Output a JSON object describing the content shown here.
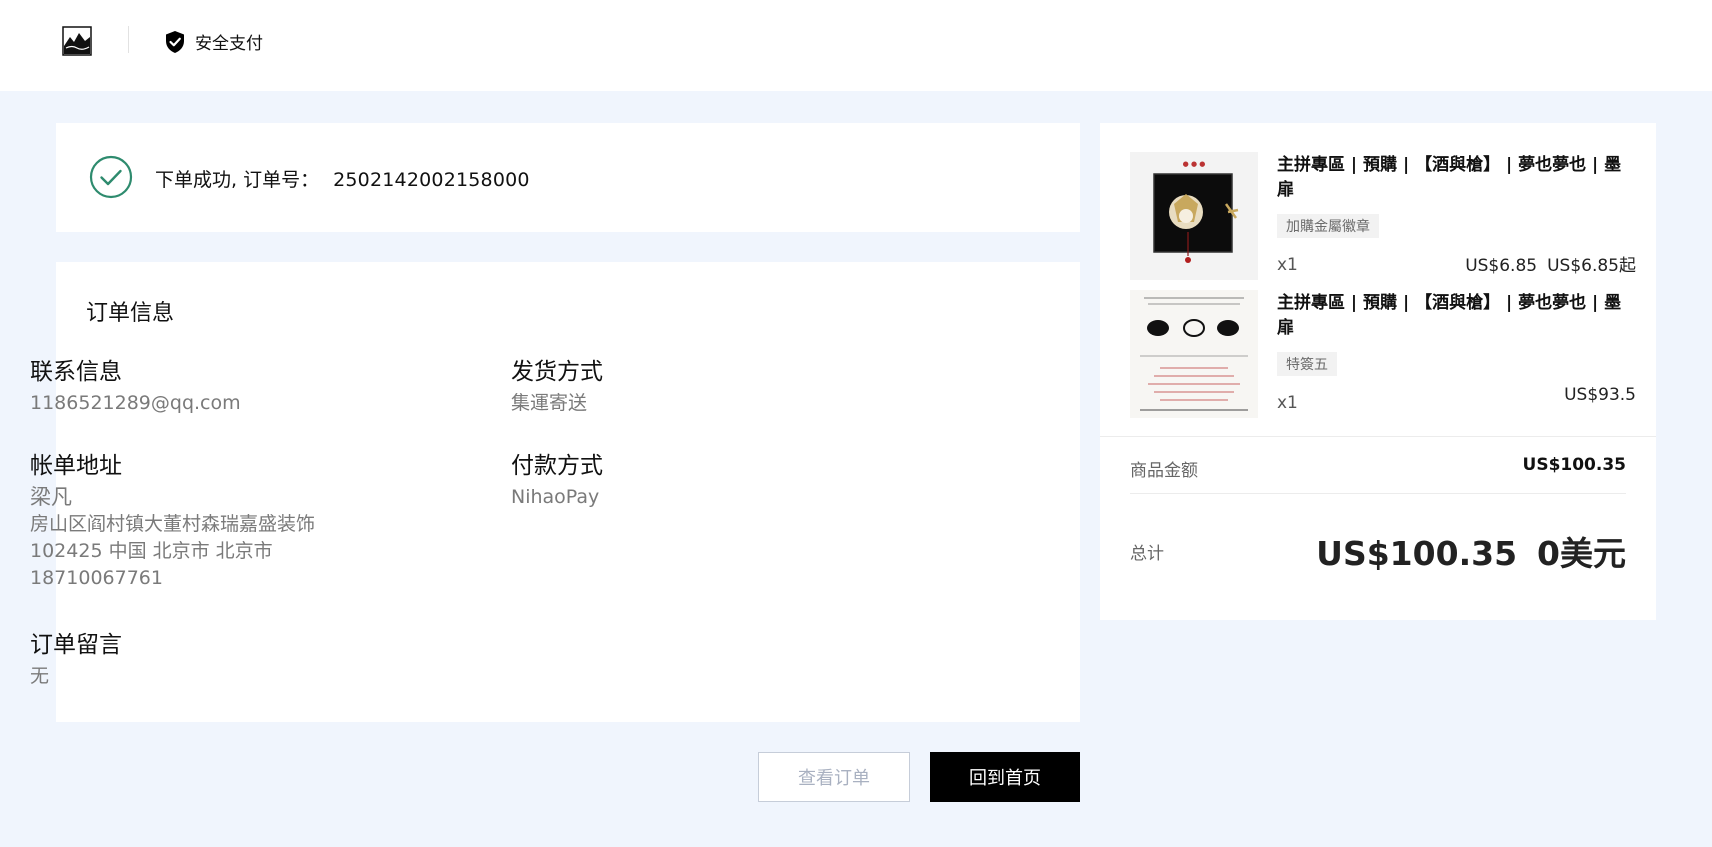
{
  "header": {
    "logo_icon": "mountain-logo-icon",
    "secure_label": "安全支付",
    "secure_icon": "shield-check-icon"
  },
  "success": {
    "icon": "check-circle-icon",
    "message": "下单成功, 订单号：",
    "order_number": "2502142002158000",
    "accent_color": "#2e8b6e"
  },
  "order_info": {
    "title": "订单信息",
    "contact": {
      "label": "联系信息",
      "value": "1186521289@qq.com"
    },
    "shipping": {
      "label": "发货方式",
      "value": "集運寄送"
    },
    "billing": {
      "label": "帐单地址",
      "name": "梁凡",
      "line1": "房山区阎村镇大董村森瑞嘉盛装饰",
      "line2": "102425 中国 北京市 北京市",
      "phone": "18710067761"
    },
    "payment": {
      "label": "付款方式",
      "value": "NihaoPay"
    },
    "note": {
      "label": "订单留言",
      "value": "无"
    }
  },
  "buttons": {
    "view_order": "查看订单",
    "back_home": "回到首页"
  },
  "summary": {
    "items": [
      {
        "title": "主拼專區 | 預購 | 【酒與槍】 | 夢也夢也 | 墨扉",
        "variant": "加購金屬徽章",
        "qty": "x1",
        "price": "US$6.85",
        "price_from": "US$6.85起"
      },
      {
        "title": "主拼專區 | 預購 | 【酒與槍】 | 夢也夢也 | 墨扉",
        "variant": "特簽五",
        "qty": "x1",
        "price": "US$93.5"
      }
    ],
    "subtotal_label": "商品金额",
    "subtotal_value": "US$100.35",
    "total_label": "总计",
    "total_value": "US$100.35",
    "total_alt": "0美元"
  }
}
